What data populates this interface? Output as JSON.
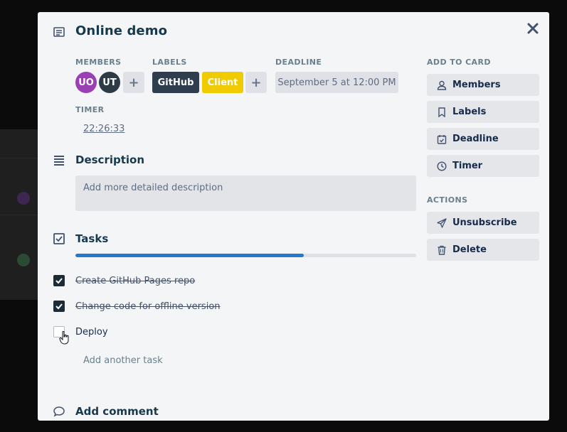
{
  "card": {
    "title": "Online demo",
    "title_icon": "card-details-icon",
    "close_icon": "close-icon"
  },
  "meta": {
    "members_label": "MEMBERS",
    "labels_label": "LABELS",
    "deadline_label": "DEADLINE",
    "timer_label": "TIMER",
    "members": [
      {
        "initials": "UO",
        "color": "#9b3fb5"
      },
      {
        "initials": "UT",
        "color": "#2e3b46"
      }
    ],
    "add_symbol": "+",
    "labels": [
      {
        "text": "GitHub",
        "color": "#2e3e4f"
      },
      {
        "text": "Client",
        "color": "#f0cb00"
      }
    ],
    "deadline_value": "September 5 at 12:00 PM",
    "timer_value": "22:26:33"
  },
  "description": {
    "title": "Description",
    "icon": "description-icon",
    "placeholder": "Add more detailed description"
  },
  "tasks": {
    "title": "Tasks",
    "icon": "tasks-icon",
    "progress_fraction": 0.67,
    "items": [
      {
        "text": "Create GitHub Pages repo",
        "done": true
      },
      {
        "text": "Change code for offline version",
        "done": true
      },
      {
        "text": "Deploy",
        "done": false
      }
    ],
    "add_task": "Add another task"
  },
  "comment": {
    "title": "Add comment",
    "icon": "comment-icon"
  },
  "sidebar": {
    "add_to_card_label": "ADD TO CARD",
    "add_items": [
      {
        "label": "Members",
        "icon": "user-icon"
      },
      {
        "label": "Labels",
        "icon": "bookmark-icon"
      },
      {
        "label": "Deadline",
        "icon": "calendar-icon"
      },
      {
        "label": "Timer",
        "icon": "clock-icon"
      }
    ],
    "actions_label": "ACTIONS",
    "action_items": [
      {
        "label": "Unsubscribe",
        "icon": "send-icon"
      },
      {
        "label": "Delete",
        "icon": "trash-icon"
      }
    ]
  },
  "colors": {
    "accent": "#2478cf",
    "checkbox_checked": "#1c2b36",
    "modal_bg": "#f4f5f7"
  }
}
